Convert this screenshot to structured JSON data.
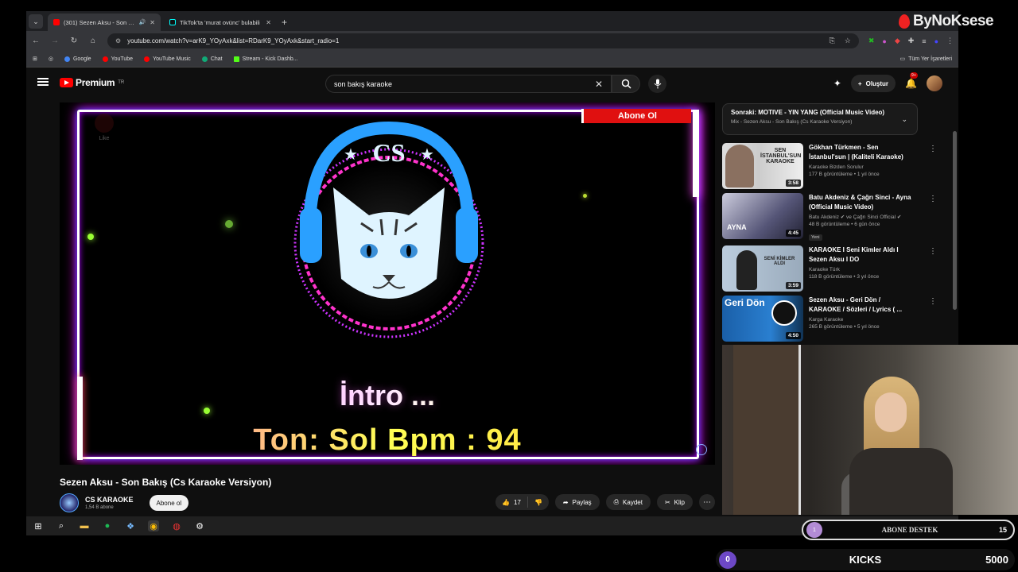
{
  "browser": {
    "tabs": [
      {
        "label": "(301) Sezen Aksu - Son Bakı",
        "active": true
      },
      {
        "label": "TikTok'ta 'murat ovünc' bulabili",
        "active": false
      }
    ],
    "url": "youtube.com/watch?v=arK9_YOyAxk&list=RDarK9_YOyAxk&start_radio=1",
    "bookmarks": [
      "Google",
      "YouTube",
      "YouTube Music",
      "Chat",
      "Stream - Kick Dashb..."
    ],
    "bookmarks_right": "Tüm Yer İşaretleri"
  },
  "youtube": {
    "logo": "Premium",
    "logo_region": "TR",
    "search_query": "son bakış karaoke",
    "create_label": "Oluştur",
    "notif_badge": "9+",
    "video": {
      "title": "Sezen Aksu - Son Bakış (Cs Karaoke Versiyon)",
      "channel": "CS KARAOKE",
      "subscribers": "1,54 B abone",
      "subscribe_label": "Abone ol",
      "likes": "17",
      "share": "Paylaş",
      "save": "Kaydet",
      "clip": "Klip"
    },
    "overlay": {
      "banner": "Abone Ol",
      "like_hint": "Like",
      "logo_text": "CS",
      "intro": "İntro ...",
      "ton": "Ton: Sol Bpm : 94"
    },
    "up_next": {
      "title": "Sonraki: MOTIVE - YIN YANG (Official Music Video)",
      "subtitle": "Mix - Sezen Aksu - Son Bakış (Cs Karaoke Versiyon)"
    },
    "recommendations": [
      {
        "title": "Gökhan Türkmen - Sen İstanbul'sun | (Kaliteli Karaoke)",
        "channel": "Karaoke Bizden Sorulur",
        "meta": "177 B görüntüleme • 1 yıl önce",
        "duration": "3:58",
        "thumb_text": "SEN İSTANBUL'SUN KARAOKE",
        "new": ""
      },
      {
        "title": "Batu Akdeniz & Çağrı Sinci - Ayna (Official Music Video)",
        "channel": "Batu Akdeniz ✔ ve Çağrı Sinci Official ✔",
        "meta": "48 B görüntüleme • 6 gün önce",
        "duration": "4:45",
        "thumb_text": "AYNA",
        "new": "Yeni"
      },
      {
        "title": "KARAOKE I Seni Kimler Aldı I Sezen Aksu I DO",
        "channel": "Karaoke Türk",
        "meta": "118 B görüntüleme • 3 yıl önce",
        "duration": "3:59",
        "thumb_text": "SENİ KİMLER ALDI",
        "new": ""
      },
      {
        "title": "Sezen Aksu - Geri Dön / KARAOKE / Sözleri / Lyrics ( ...",
        "channel": "Karga Karaoke",
        "meta": "265 B görüntüleme • 5 yıl önce",
        "duration": "4:50",
        "thumb_text": "Geri Dön",
        "new": ""
      }
    ]
  },
  "stream": {
    "brand": "ByNoKsese",
    "goal_label": "ABONE DESTEK",
    "goal_current": "1",
    "goal_target": "15",
    "kicks_label": "KICKS",
    "kicks_current": "0",
    "kicks_target": "5000"
  },
  "colors": {
    "accent": "#ff0000",
    "kick_purple": "#6d48c6",
    "banner_red": "#e01010"
  }
}
